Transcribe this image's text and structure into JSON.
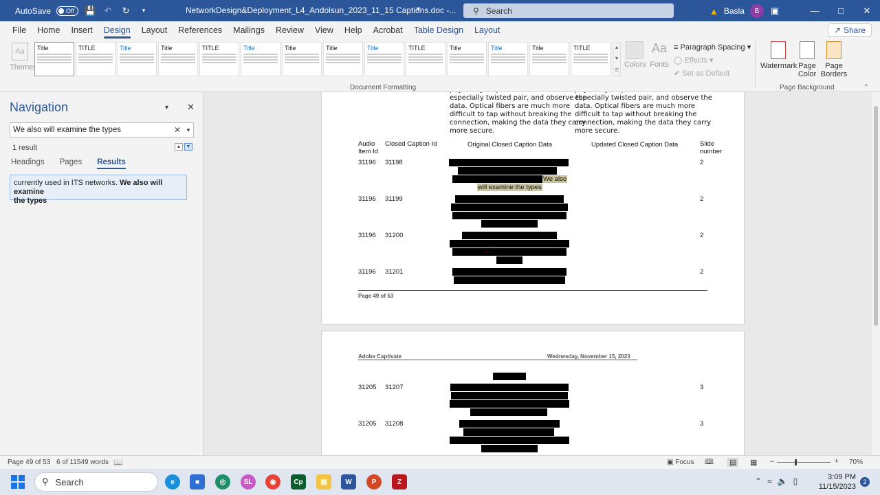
{
  "titlebar": {
    "autosave_label": "AutoSave",
    "autosave_state": "Off",
    "doc_title": "NetworkDesign&Deployment_L4_Andolsun_2023_11_15 Captions.doc  -...",
    "search_placeholder": "Search",
    "user_name": "Basla",
    "user_initial": "B"
  },
  "tabs": [
    "File",
    "Home",
    "Insert",
    "Design",
    "Layout",
    "References",
    "Mailings",
    "Review",
    "View",
    "Help",
    "Acrobat",
    "Table Design",
    "Layout"
  ],
  "share_label": "Share",
  "ribbon": {
    "themes_label": "Themes",
    "colors_label": "Colors",
    "fonts_label": "Fonts",
    "paragraph_spacing": "Paragraph Spacing",
    "effects": "Effects",
    "set_as_default": "Set as Default",
    "document_formatting": "Document Formatting",
    "watermark": "Watermark",
    "page_color": "Page Color",
    "page_borders": "Page Borders",
    "page_background": "Page Background",
    "style_titles": [
      "Title",
      "TITLE",
      "Title",
      "Title",
      "TITLE",
      "Title",
      "Title",
      "Title",
      "Title",
      "TITLE",
      "Title",
      "Title",
      "Title",
      "TITLE"
    ]
  },
  "navigation": {
    "title": "Navigation",
    "search_value": "We also will examine the types",
    "result_count": "1 result",
    "tabs": [
      "Headings",
      "Pages",
      "Results"
    ],
    "result_text_plain": "currently used in ITS networks. ",
    "result_text_bold_1": "We also will examine",
    "result_text_bold_2": "the types"
  },
  "document": {
    "col1_text": [
      "physically \"tap\" in to the cables,",
      "especially twisted pair, and observe the",
      "data. Optical fibers are much more",
      "difficult to tap without breaking the",
      "connection, making the data they carry",
      "more secure."
    ],
    "col2_text": [
      "physically \"tap\" in to the cables,",
      "especially twisted pair, and observe the",
      "data. Optical fibers are much more",
      "difficult to tap without breaking the",
      "connection, making the data they carry",
      "more secure."
    ],
    "headers": {
      "audio_item_id_1": "Audio",
      "audio_item_id_2": "Item Id",
      "closed_caption_id": "Closed Caption Id",
      "original": "Original Closed Caption Data",
      "updated": "Updated Closed Caption Data",
      "slide_1": "Slide",
      "slide_2": "number"
    },
    "rows_page1": [
      {
        "audio": "31196",
        "caption": "31198",
        "slide": "2"
      },
      {
        "audio": "31196",
        "caption": "31199",
        "slide": "2"
      },
      {
        "audio": "31196",
        "caption": "31200",
        "slide": "2"
      },
      {
        "audio": "31196",
        "caption": "31201",
        "slide": "2"
      }
    ],
    "highlight_1": "We also",
    "highlight_2": "will examine the types",
    "page_footer": "Page 49 of 53",
    "page2_header_left": "Adobe Captivate",
    "page2_header_right": "Wednesday, November 15, 2023",
    "rows_page2": [
      {
        "audio": "31205",
        "caption": "31207",
        "slide": "3"
      },
      {
        "audio": "31205",
        "caption": "31208",
        "slide": "3"
      }
    ]
  },
  "status": {
    "page": "Page 49 of 53",
    "words": "6 of 11549 words",
    "focus": "Focus",
    "zoom": "70%"
  },
  "taskbar": {
    "search": "Search",
    "time": "3:09 PM",
    "date": "11/15/2023",
    "notifications": "2"
  }
}
